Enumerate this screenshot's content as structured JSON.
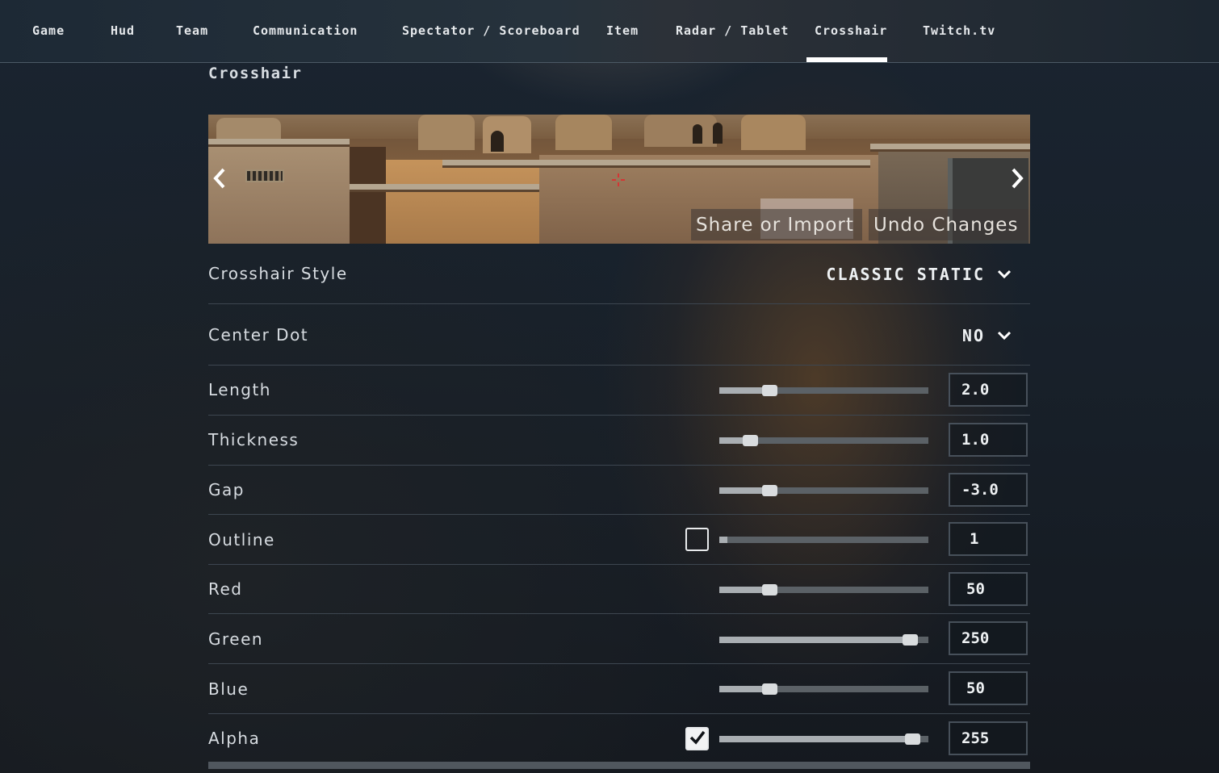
{
  "nav": {
    "tabs": [
      {
        "label": "Game"
      },
      {
        "label": "Hud"
      },
      {
        "label": "Team"
      },
      {
        "label": "Communication"
      },
      {
        "label": "Spectator / Scoreboard"
      },
      {
        "label": "Item"
      },
      {
        "label": "Radar / Tablet"
      },
      {
        "label": "Crosshair"
      },
      {
        "label": "Twitch.tv"
      }
    ],
    "active_tab": "Crosshair"
  },
  "section": {
    "title": "Crosshair"
  },
  "preview": {
    "share_label": "Share or Import",
    "undo_label": "Undo Changes",
    "prev_icon": "chevron-left-icon",
    "next_icon": "chevron-right-icon",
    "crosshair_color": "#d43535"
  },
  "settings": {
    "style": {
      "label": "Crosshair Style",
      "value": "CLASSIC STATIC"
    },
    "center_dot": {
      "label": "Center Dot",
      "value": "NO"
    },
    "length": {
      "label": "Length",
      "value": "2.0",
      "fill": 0.22
    },
    "thickness": {
      "label": "Thickness",
      "value": "1.0",
      "fill": 0.12
    },
    "gap": {
      "label": "Gap",
      "value": "-3.0",
      "fill": 0.22
    },
    "outline": {
      "label": "Outline",
      "value": "1",
      "fill": 0.0,
      "checked": false
    },
    "red": {
      "label": "Red",
      "value": "50",
      "fill": 0.22
    },
    "green": {
      "label": "Green",
      "value": "250",
      "fill": 0.945
    },
    "blue": {
      "label": "Blue",
      "value": "50",
      "fill": 0.22
    },
    "alpha": {
      "label": "Alpha",
      "value": "255",
      "fill": 0.96,
      "checked": true
    }
  },
  "colors": {
    "accent": "#ffffff",
    "slider_track": "#5b6166",
    "slider_fill": "#a9aeb2"
  }
}
